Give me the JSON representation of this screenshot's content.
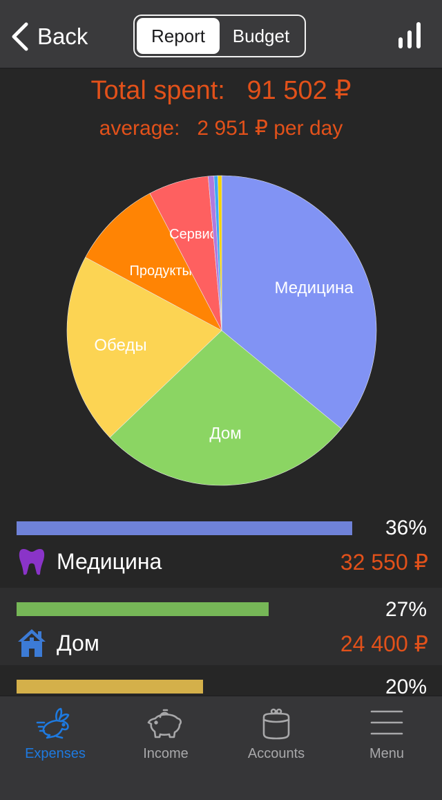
{
  "navbar": {
    "back_label": "Back",
    "segments": [
      "Report",
      "Budget"
    ],
    "selected_segment": "Report"
  },
  "summary": {
    "total_label": "Total spent:",
    "total_value": "91 502 ₽",
    "average_label": "average:",
    "average_value": "2 951 ₽ per day"
  },
  "chart_data": {
    "type": "pie",
    "slices": [
      {
        "label": "Медицина",
        "percent": 36,
        "color": "#8193f4"
      },
      {
        "label": "Дом",
        "percent": 27,
        "color": "#8bd563"
      },
      {
        "label": "Обеды",
        "percent": 20,
        "color": "#fcd453"
      },
      {
        "label": "Продукты",
        "percent": 9.5,
        "color": "#ff8404"
      },
      {
        "label": "Сервис",
        "percent": 6.3,
        "color": "#fe6060"
      },
      {
        "label": "",
        "percent": 0.6,
        "color": "#b07adf"
      },
      {
        "label": "",
        "percent": 0.4,
        "color": "#3ea6f5"
      },
      {
        "label": "",
        "percent": 0.4,
        "color": "#f6d400"
      }
    ]
  },
  "categories": [
    {
      "name": "Медицина",
      "percent_label": "36%",
      "percent": 36,
      "amount": "32 550 ₽",
      "bar_color": "#6f82d8",
      "icon": "tooth-icon",
      "icon_color": "#8a34c8"
    },
    {
      "name": "Дом",
      "percent_label": "27%",
      "percent": 27,
      "amount": "24 400 ₽",
      "bar_color": "#76b757",
      "icon": "house-icon",
      "icon_color": "#3c7bd6"
    },
    {
      "name": "",
      "percent_label": "20%",
      "percent": 20,
      "amount": "",
      "bar_color": "#d4b04a",
      "icon": "",
      "icon_color": ""
    }
  ],
  "tabbar": {
    "items": [
      {
        "label": "Expenses",
        "icon": "rabbit-icon",
        "active": true
      },
      {
        "label": "Income",
        "icon": "piggy-bank-icon",
        "active": false
      },
      {
        "label": "Accounts",
        "icon": "wallet-icon",
        "active": false
      },
      {
        "label": "Menu",
        "icon": "menu-icon",
        "active": false
      }
    ]
  },
  "colors": {
    "accent": "#e2511a",
    "active_tab": "#1e7ae0",
    "inactive_tab": "#a8a8aa"
  }
}
